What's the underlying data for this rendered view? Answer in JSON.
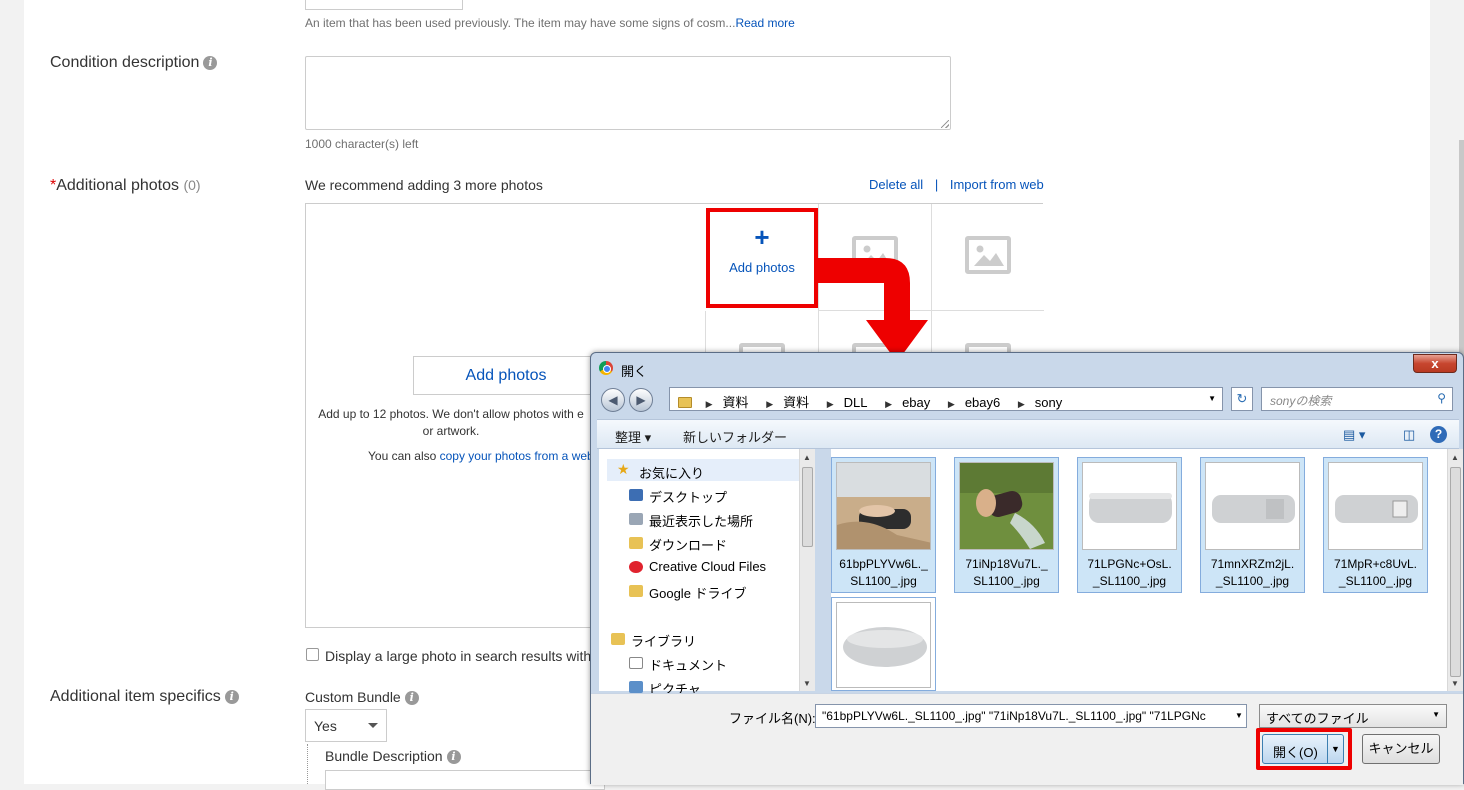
{
  "form": {
    "condition_note": "An item that has been used previously. The item may have some signs of cosm...",
    "read_more": "Read more",
    "condition_description_label": "Condition description",
    "chars_left": "1000 character(s) left",
    "photos_required_mark": "*",
    "photos_label": "Additional photos",
    "photos_count": "(0)",
    "recommend_text": "We recommend adding 3 more photos",
    "delete_all": "Delete all",
    "separator": "|",
    "import_from_web": "Import from web",
    "add_photos_cell": "Add photos",
    "add_photos_plus": "+",
    "add_photos_button": "Add photos",
    "add_up_to_line1": "Add up to 12 photos. We don't allow photos with e",
    "add_up_to_line2": "or artwork.",
    "you_can_also": "You can also",
    "copy_link": "copy your photos from a web",
    "large_photo_label": "Display a large photo in search results with",
    "item_specifics_label": "Additional item specifics",
    "custom_bundle_label": "Custom Bundle",
    "custom_bundle_value": "Yes",
    "bundle_description_label": "Bundle Description",
    "info_glyph": "i"
  },
  "dialog": {
    "title": "開く",
    "close": "x",
    "back": "◀",
    "forward": "▶",
    "breadcrumbs": [
      "資料",
      "資料",
      "DLL",
      "ebay",
      "ebay6",
      "sony"
    ],
    "search_placeholder": "sonyの検索",
    "organize": "整理 ▾",
    "new_folder": "新しいフォルダー",
    "nav": {
      "favorites": "お気に入り",
      "items": [
        "デスクトップ",
        "最近表示した場所",
        "ダウンロード",
        "Creative Cloud Files",
        "Google ドライブ"
      ],
      "library": "ライブラリ",
      "library_items": [
        "ドキュメント",
        "ピクチャ"
      ]
    },
    "files": [
      {
        "line1": "61bpPLYVw6L._",
        "line2": "SL1100_.jpg"
      },
      {
        "line1": "71iNp18Vu7L._",
        "line2": "SL1100_.jpg"
      },
      {
        "line1": "71LPGNc+OsL.",
        "line2": "_SL1100_.jpg"
      },
      {
        "line1": "71mnXRZm2jL.",
        "line2": "_SL1100_.jpg"
      },
      {
        "line1": "71MpR+c8UvL.",
        "line2": "_SL1100_.jpg"
      }
    ],
    "filename_label": "ファイル名(N):",
    "filename_value": "\"61bpPLYVw6L._SL1100_.jpg\" \"71iNp18Vu7L._SL1100_.jpg\" \"71LPGNc",
    "filetype": "すべてのファイル",
    "open_button": "開く(O)",
    "cancel_button": "キャンセル"
  },
  "colors": {
    "link": "#0654ba",
    "highlight": "#ee0000",
    "dialog_frame": "#c9d8ea"
  }
}
